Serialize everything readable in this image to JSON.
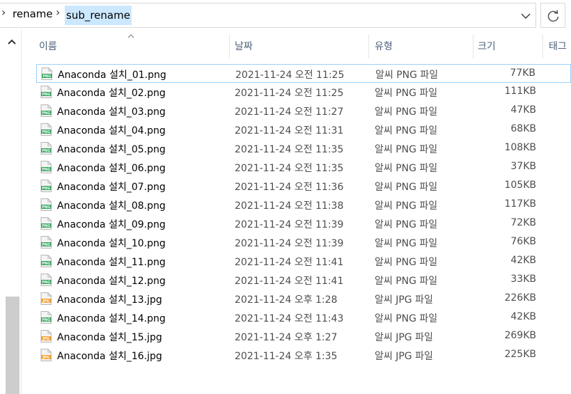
{
  "address": {
    "crumbs": [
      "rename",
      "sub_rename"
    ]
  },
  "columns": {
    "name": "이름",
    "date": "날짜",
    "type": "유형",
    "size": "크기",
    "tags": "태그"
  },
  "files": [
    {
      "name": "Anaconda 설치_01.png",
      "date": "2021-11-24 오전 11:25",
      "type": "알씨 PNG 파일",
      "size": "77KB",
      "icon": "png-file-icon"
    },
    {
      "name": "Anaconda 설치_02.png",
      "date": "2021-11-24 오전 11:25",
      "type": "알씨 PNG 파일",
      "size": "111KB",
      "icon": "png-file-icon"
    },
    {
      "name": "Anaconda 설치_03.png",
      "date": "2021-11-24 오전 11:27",
      "type": "알씨 PNG 파일",
      "size": "47KB",
      "icon": "png-file-icon"
    },
    {
      "name": "Anaconda 설치_04.png",
      "date": "2021-11-24 오전 11:31",
      "type": "알씨 PNG 파일",
      "size": "68KB",
      "icon": "png-file-icon"
    },
    {
      "name": "Anaconda 설치_05.png",
      "date": "2021-11-24 오전 11:35",
      "type": "알씨 PNG 파일",
      "size": "108KB",
      "icon": "png-file-icon"
    },
    {
      "name": "Anaconda 설치_06.png",
      "date": "2021-11-24 오전 11:35",
      "type": "알씨 PNG 파일",
      "size": "37KB",
      "icon": "png-file-icon"
    },
    {
      "name": "Anaconda 설치_07.png",
      "date": "2021-11-24 오전 11:36",
      "type": "알씨 PNG 파일",
      "size": "105KB",
      "icon": "png-file-icon"
    },
    {
      "name": "Anaconda 설치_08.png",
      "date": "2021-11-24 오전 11:38",
      "type": "알씨 PNG 파일",
      "size": "117KB",
      "icon": "png-file-icon"
    },
    {
      "name": "Anaconda 설치_09.png",
      "date": "2021-11-24 오전 11:39",
      "type": "알씨 PNG 파일",
      "size": "72KB",
      "icon": "png-file-icon"
    },
    {
      "name": "Anaconda 설치_10.png",
      "date": "2021-11-24 오전 11:39",
      "type": "알씨 PNG 파일",
      "size": "76KB",
      "icon": "png-file-icon"
    },
    {
      "name": "Anaconda 설치_11.png",
      "date": "2021-11-24 오전 11:41",
      "type": "알씨 PNG 파일",
      "size": "42KB",
      "icon": "png-file-icon"
    },
    {
      "name": "Anaconda 설치_12.png",
      "date": "2021-11-24 오전 11:41",
      "type": "알씨 PNG 파일",
      "size": "33KB",
      "icon": "png-file-icon"
    },
    {
      "name": "Anaconda 설치_13.jpg",
      "date": "2021-11-24 오후 1:28",
      "type": "알씨 JPG 파일",
      "size": "226KB",
      "icon": "jpg-file-icon"
    },
    {
      "name": "Anaconda 설치_14.png",
      "date": "2021-11-24 오전 11:43",
      "type": "알씨 PNG 파일",
      "size": "42KB",
      "icon": "png-file-icon"
    },
    {
      "name": "Anaconda 설치_15.jpg",
      "date": "2021-11-24 오후 1:27",
      "type": "알씨 JPG 파일",
      "size": "269KB",
      "icon": "jpg-file-icon"
    },
    {
      "name": "Anaconda 설치_16.jpg",
      "date": "2021-11-24 오후 1:35",
      "type": "알씨 JPG 파일",
      "size": "225KB",
      "icon": "jpg-file-icon"
    }
  ],
  "icon_labels": {
    "png": "PNG",
    "jpg": "JPG"
  },
  "colors": {
    "png": "#2fa35a",
    "jpg": "#f0a030",
    "selection": "#cce8ff",
    "focus": "#99d1ff"
  }
}
